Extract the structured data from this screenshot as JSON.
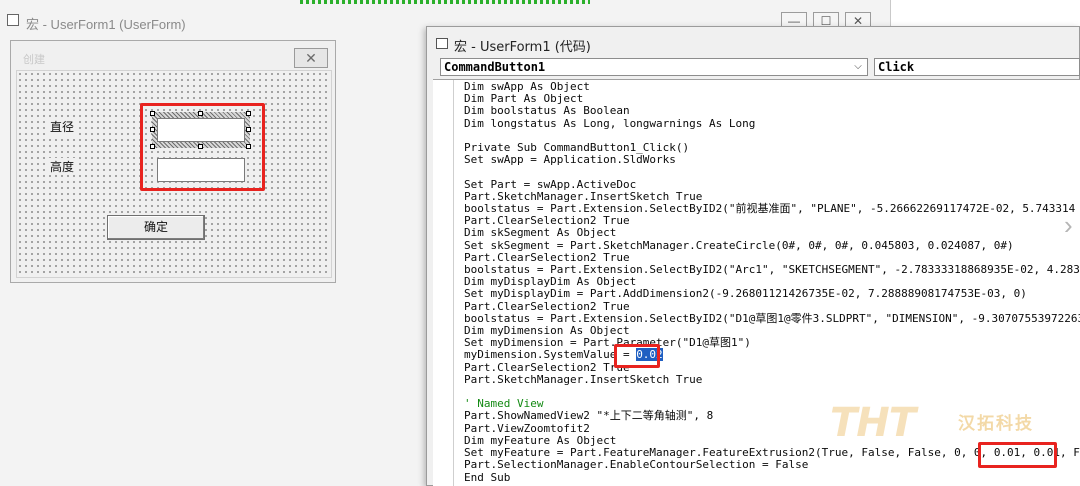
{
  "left_window": {
    "title": "宏 - UserForm1 (UserForm)",
    "buttons": {
      "minimize": "—",
      "maximize": "☐",
      "close": "✕"
    }
  },
  "form": {
    "caption": "创建",
    "close_glyph": "✕",
    "label_diameter": "直径",
    "label_height": "高度",
    "ok_button": "确定"
  },
  "code_window": {
    "title": "宏 - UserForm1 (代码)",
    "object_combo": "CommandButton1",
    "procedure_combo": "Click",
    "code_before_value": "Dim swApp As Object\nDim Part As Object\nDim boolstatus As Boolean\nDim longstatus As Long, longwarnings As Long\n\nPrivate Sub CommandButton1_Click()\nSet swApp = Application.SldWorks\n\nSet Part = swApp.ActiveDoc\nPart.SketchManager.InsertSketch True\nboolstatus = Part.Extension.SelectByID2(\"前视基准面\", \"PLANE\", -5.26662269117472E-02, 5.743314\nPart.ClearSelection2 True\nDim skSegment As Object\nSet skSegment = Part.SketchManager.CreateCircle(0#, 0#, 0#, 0.045803, 0.024087, 0#)\nPart.ClearSelection2 True\nboolstatus = Part.Extension.SelectByID2(\"Arc1\", \"SKETCHSEGMENT\", -2.78333318868935E-02, 4.2837\nDim myDisplayDim As Object\nSet myDisplayDim = Part.AddDimension2(-9.26801121426735E-02, 7.28888908174753E-03, 0)\nPart.ClearSelection2 True\nboolstatus = Part.Extension.SelectByID2(\"D1@草图1@零件3.SLDPRT\", \"DIMENSION\", -9.30707553972263\nDim myDimension As Object\nSet myDimension = Part.Parameter(\"D1@草图1\")\nmyDimension.SystemValue = ",
    "selected_value": "0.02",
    "code_after_value": "\nPart.ClearSelection2 True\nPart.SketchManager.InsertSketch True\n\n",
    "comment_line": "' Named View",
    "code_tail_1": "\nPart.ShowNamedView2 \"*上下二等角轴测\", 8\nPart.ViewZoomtofit2\nDim myFeature As Object\nSet myFeature = Part.FeatureManager.FeatureExtrusion2(True, False, False, 0, 0, ",
    "extrude_values": "0.01, 0.01",
    "code_tail_2": ", Fa\nPart.SelectionManager.EnableContourSelection = False\nEnd Sub"
  },
  "watermark": {
    "logo": "THT",
    "company": "汉拓科技"
  },
  "colors": {
    "highlight": "#1f5fc2",
    "annotation": "#e8231f",
    "comment": "#138a13"
  }
}
